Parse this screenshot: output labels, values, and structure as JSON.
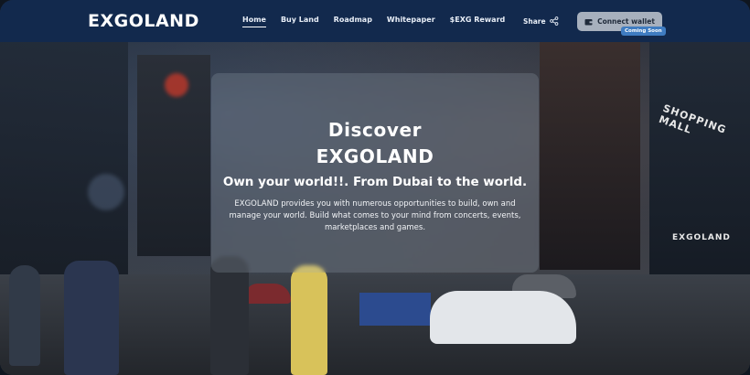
{
  "header": {
    "logo": "EXGOLAND",
    "nav": [
      {
        "label": "Home",
        "active": true
      },
      {
        "label": "Buy Land",
        "active": false
      },
      {
        "label": "Roadmap",
        "active": false
      },
      {
        "label": "Whitepaper",
        "active": false
      },
      {
        "label": "$EXG Reward",
        "active": false
      }
    ],
    "share_label": "Share",
    "connect_label": "Connect wallet",
    "coming_soon_badge": "Coming Soon",
    "icons": {
      "share": "share-icon",
      "wallet": "wallet-icon"
    }
  },
  "hero": {
    "line1": "Discover",
    "line2": "EXGOLAND",
    "subtitle": "Own your world!!. From Dubai to the world.",
    "description": "EXGOLAND provides you with numerous opportunities to build, own and manage your world. Build what comes to your mind from concerts, events, marketplaces and games."
  },
  "background": {
    "signs": [
      "SHOPPING MALL",
      "EXGOLAND"
    ]
  },
  "colors": {
    "header_bg": "#12294d",
    "connect_button_bg": "#a7b0bd",
    "badge_bg": "#3f7cc1"
  }
}
